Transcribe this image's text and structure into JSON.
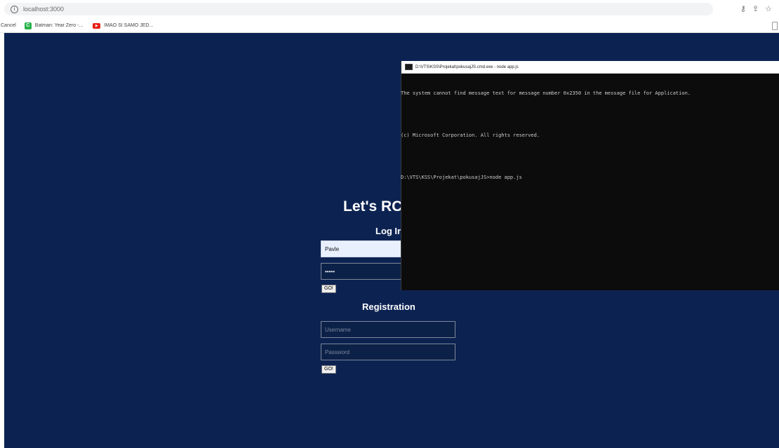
{
  "browser": {
    "url": "localhost:3000",
    "icons": [
      "key-icon",
      "share-icon",
      "star-icon"
    ]
  },
  "bookmarks": [
    {
      "label": "Cancel"
    },
    {
      "label": "Batman: Year Zero -...",
      "favicon": "green-c"
    },
    {
      "label": "IMAO SI SAMO JED...",
      "favicon": "youtube"
    }
  ],
  "page": {
    "heading": "Let's RC",
    "login": {
      "title": "Log Ir",
      "username_value": "Pavle",
      "password_value": "•••••",
      "button": "GO!"
    },
    "registration": {
      "title": "Registration",
      "username_placeholder": "Username",
      "password_placeholder": "Password",
      "button": "GO!"
    }
  },
  "console": {
    "title": "D:\\VTS\\KSS\\Projekat\\pokusajJS.cmd.exe - node app.js",
    "lines": [
      "The system cannot find message text for message number 0x2350 in the message file for Application.",
      "",
      "(c) Microsoft Corporation. All rights reserved.",
      "",
      "D:\\VTS\\KSS\\Projekat\\pokusajJS>node app.js"
    ]
  },
  "colors": {
    "page_background": "#0c2352",
    "console_background": "#0c0c0c",
    "autofill_background": "#e8f0fe"
  }
}
